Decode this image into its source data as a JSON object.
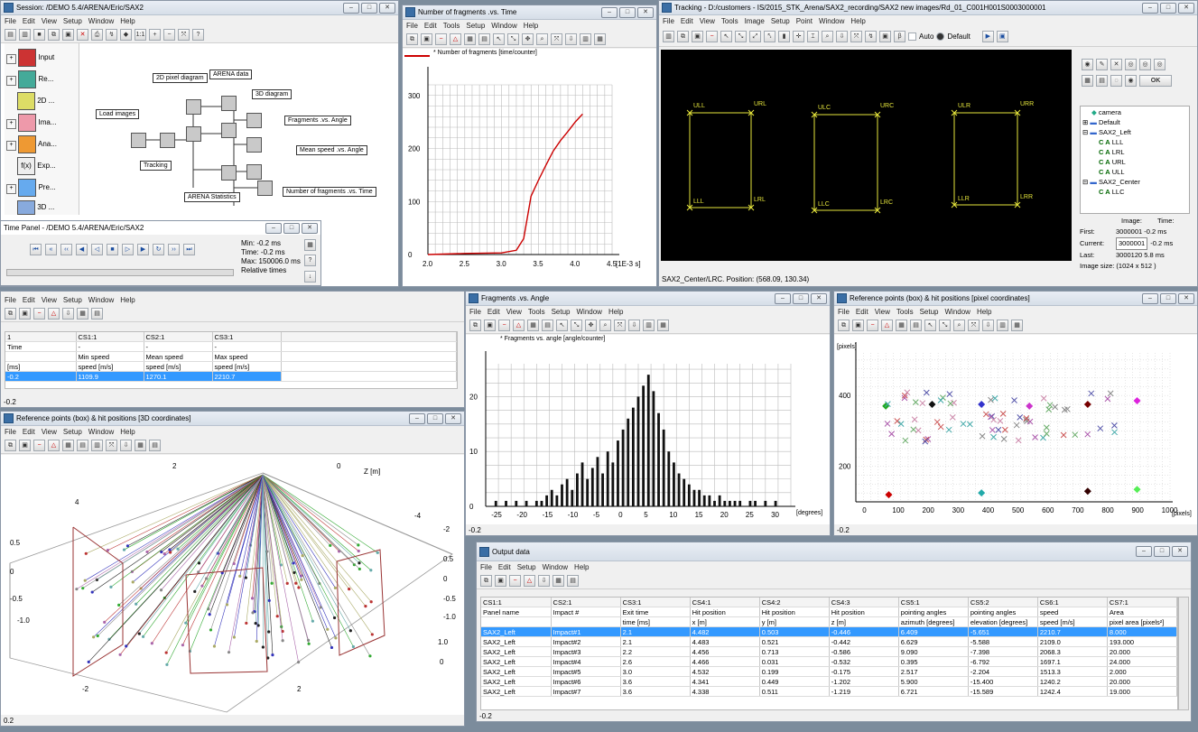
{
  "session": {
    "title": "Session: /DEMO 5.4/ARENA/Eric/SAX2",
    "menu": [
      "File",
      "Edit",
      "View",
      "Setup",
      "Window",
      "Help"
    ],
    "left_items": [
      "Input",
      "Re...",
      "2D ...",
      "Ima...",
      "Ana...",
      "Exp...",
      "Pre...",
      "3D ..."
    ],
    "nodes": {
      "pixel2d": "2D pixel diagram",
      "arena_data": "ARENA data",
      "diagram3d": "3D diagram",
      "load_images": "Load images",
      "frag_angle": "Fragments .vs. Angle",
      "mean_speed": "Mean speed .vs. Angle",
      "tracking": "Tracking",
      "num_frag_time": "Number of fragments .vs. Time",
      "arena_stats": "ARENA Statistics"
    }
  },
  "time_panel": {
    "title": "Time Panel - /DEMO 5.4/ARENA/Eric/SAX2",
    "min": "Min:  -0.2 ms",
    "time": "Time:  -0.2 ms",
    "max": "Max:  150006.0 ms",
    "relative": "Relative times"
  },
  "speed_table": {
    "menu": [
      "File",
      "Edit",
      "View",
      "Setup",
      "Window",
      "Help"
    ],
    "cols": [
      "1",
      "CS1:1",
      "CS2:1",
      "CS3:1"
    ],
    "hdr1": [
      "Time",
      "-",
      "-",
      "-"
    ],
    "hdr2": [
      "",
      "Min speed",
      "Mean speed",
      "Max speed"
    ],
    "hdr3": [
      "[ms]",
      "speed [m/s]",
      "speed [m/s]",
      "speed [m/s]"
    ],
    "row": [
      "-0.2",
      "1109.9",
      "1270.1",
      "2210.7"
    ],
    "status": "-0.2"
  },
  "frag_time": {
    "title": "Number of fragments .vs. Time",
    "menu": [
      "File",
      "Edit",
      "Tools",
      "Setup",
      "Window",
      "Help"
    ],
    "legend": "* Number of fragments [time/counter]"
  },
  "tracking": {
    "title": "Tracking - D:/customers - IS/2015_STK_Arena/SAX2_recording/SAX2 new images/Rd_01_C001H001S0003000001",
    "menu": [
      "File",
      "Edit",
      "View",
      "Tools",
      "Image",
      "Setup",
      "Point",
      "Window",
      "Help"
    ],
    "auto": "Auto",
    "default": "Default",
    "ok": "OK",
    "boxes": [
      {
        "tl": "ULL",
        "tr": "URL",
        "bl": "LLL",
        "br": "LRL"
      },
      {
        "tl": "ULC",
        "tr": "URC",
        "bl": "LLC",
        "br": "LRC"
      },
      {
        "tl": "ULR",
        "tr": "URR",
        "bl": "LLR",
        "br": "LRR"
      }
    ],
    "tree": [
      "camera",
      "Default",
      "SAX2_Left",
      "LLL",
      "LRL",
      "URL",
      "ULL",
      "SAX2_Center",
      "LLC"
    ],
    "info_image": "Image:",
    "info_time": "Time:",
    "first": "First:",
    "first_val": "3000001  -0.2 ms",
    "current": "Current:",
    "current_val": "3000001",
    "current_time": "-0.2 ms",
    "last": "Last:",
    "last_val": "3000120  5.8 ms",
    "image_size": "Image size:  (1024 x 512 )",
    "status": "SAX2_Center/LRC. Position: (568.09, 130.34)"
  },
  "frag_angle": {
    "title": "Fragments .vs. Angle",
    "menu": [
      "File",
      "Edit",
      "View",
      "Tools",
      "Setup",
      "Window",
      "Help"
    ],
    "legend": "* Fragments vs. angle [angle/counter]",
    "xunit": "[degrees]",
    "status": "-0.2"
  },
  "ref_pixel": {
    "title": "Reference points (box) & hit positions  [pixel coordinates]",
    "menu": [
      "File",
      "Edit",
      "View",
      "Tools",
      "Setup",
      "Window",
      "Help"
    ],
    "yunit": "[pixels]",
    "xunit": "[pixels]",
    "status": "-0.2"
  },
  "ref_3d": {
    "title": "Reference points (box) & hit positions  [3D coordinates]",
    "menu": [
      "File",
      "Edit",
      "View",
      "Setup",
      "Window",
      "Help"
    ],
    "zlabel": "Z [m]",
    "status": "0.2"
  },
  "output": {
    "title": "Output data",
    "menu": [
      "File",
      "Edit",
      "Setup",
      "Window",
      "Help"
    ],
    "cols": [
      "CS1:1",
      "CS2:1",
      "CS3:1",
      "CS4:1",
      "CS4:2",
      "CS4:3",
      "CS5:1",
      "CS5:2",
      "CS6:1",
      "CS7:1"
    ],
    "hdr1": [
      "Panel name",
      "Impact #",
      "Exit time",
      "Hit position",
      "Hit position",
      "Hit position",
      "pointing angles",
      "pointing angles",
      "speed",
      "Area"
    ],
    "hdr2": [
      "",
      "",
      "time [ms]",
      "x [m]",
      "y [m]",
      "z [m]",
      "azimuth [degrees]",
      "elevation [degrees]",
      "speed [m/s]",
      "pixel area [pixels²]"
    ],
    "rows": [
      [
        "SAX2_Left",
        "Impact#1",
        "2.1",
        "4.482",
        "0.503",
        "-0.446",
        "6.409",
        "-5.651",
        "2210.7",
        "8.000"
      ],
      [
        "SAX2_Left",
        "Impact#2",
        "2.1",
        "4.483",
        "0.521",
        "-0.442",
        "6.629",
        "-5.588",
        "2109.0",
        "193.000"
      ],
      [
        "SAX2_Left",
        "Impact#3",
        "2.2",
        "4.456",
        "0.713",
        "-0.586",
        "9.090",
        "-7.398",
        "2068.3",
        "20.000"
      ],
      [
        "SAX2_Left",
        "Impact#4",
        "2.6",
        "4.466",
        "0.031",
        "-0.532",
        "0.395",
        "-6.792",
        "1697.1",
        "24.000"
      ],
      [
        "SAX2_Left",
        "Impact#5",
        "3.0",
        "4.532",
        "0.199",
        "-0.175",
        "2.517",
        "-2.204",
        "1513.3",
        "2.000"
      ],
      [
        "SAX2_Left",
        "Impact#6",
        "3.6",
        "4.341",
        "0.449",
        "-1.202",
        "5.900",
        "-15.400",
        "1240.2",
        "20.000"
      ],
      [
        "SAX2_Left",
        "Impact#7",
        "3.6",
        "4.338",
        "0.511",
        "-1.219",
        "6.721",
        "-15.589",
        "1242.4",
        "19.000"
      ]
    ],
    "status": "-0.2"
  },
  "chart_data": [
    {
      "type": "line",
      "title": "",
      "series": [
        {
          "name": "Number of fragments [time/counter]",
          "x": [
            2.0,
            2.5,
            3.0,
            3.2,
            3.3,
            3.35,
            3.4,
            3.5,
            3.6,
            3.7,
            3.8,
            3.9,
            4.0,
            4.1
          ],
          "values": [
            0,
            2,
            3,
            8,
            30,
            70,
            110,
            140,
            168,
            195,
            215,
            232,
            250,
            265
          ]
        }
      ],
      "xlabel": "[1E-3 s]",
      "xticks": [
        2.0,
        2.5,
        3.0,
        3.5,
        4.0,
        4.5
      ],
      "yticks": [
        0,
        100,
        200,
        300
      ],
      "xlim": [
        2.0,
        4.5
      ],
      "ylim": [
        0,
        320
      ],
      "grid": true
    },
    {
      "type": "bar",
      "title": "",
      "series": [
        {
          "name": "Fragments vs. angle [angle/counter]",
          "x": [
            -25,
            -24,
            -23,
            -22,
            -21,
            -20,
            -19,
            -18,
            -17,
            -16,
            -15,
            -14,
            -13,
            -12,
            -11,
            -10,
            -9,
            -8,
            -7,
            -6,
            -5,
            -4,
            -3,
            -2,
            -1,
            0,
            1,
            2,
            3,
            4,
            5,
            6,
            7,
            8,
            9,
            10,
            11,
            12,
            13,
            14,
            15,
            16,
            17,
            18,
            19,
            20,
            21,
            22,
            23,
            24,
            25,
            26,
            27,
            28,
            29,
            30
          ],
          "values": [
            1,
            0,
            1,
            0,
            1,
            0,
            1,
            0,
            1,
            1,
            2,
            3,
            2,
            4,
            5,
            3,
            6,
            8,
            5,
            7,
            9,
            6,
            10,
            8,
            12,
            14,
            16,
            18,
            20,
            22,
            24,
            21,
            17,
            14,
            10,
            8,
            6,
            5,
            4,
            3,
            3,
            2,
            2,
            1,
            2,
            1,
            1,
            1,
            1,
            0,
            1,
            1,
            0,
            1,
            0,
            1
          ]
        }
      ],
      "xlabel": "[degrees]",
      "xticks": [
        -25,
        -20,
        -15,
        -10,
        -5,
        0,
        5,
        10,
        15,
        20,
        25,
        30
      ],
      "yticks": [
        0,
        10,
        20
      ],
      "xlim": [
        -27,
        33
      ],
      "ylim": [
        0,
        26
      ],
      "grid": true
    },
    {
      "type": "scatter",
      "title": "",
      "xlabel": "[pixels]",
      "ylabel": "[pixels]",
      "xticks": [
        0,
        100,
        200,
        300,
        400,
        500,
        600,
        700,
        800,
        900,
        1000
      ],
      "yticks": [
        200,
        400
      ],
      "xlim": [
        -40,
        1010
      ],
      "ylim": [
        100,
        520
      ],
      "grid": true,
      "series": [
        {
          "name": "reference points",
          "points": [
            [
              60,
              370
            ],
            [
              215,
              375
            ],
            [
              380,
              375
            ],
            [
              540,
              370
            ],
            [
              735,
              375
            ],
            [
              900,
              385
            ],
            [
              70,
              120
            ],
            [
              380,
              125
            ],
            [
              735,
              130
            ],
            [
              900,
              135
            ]
          ]
        }
      ]
    }
  ]
}
